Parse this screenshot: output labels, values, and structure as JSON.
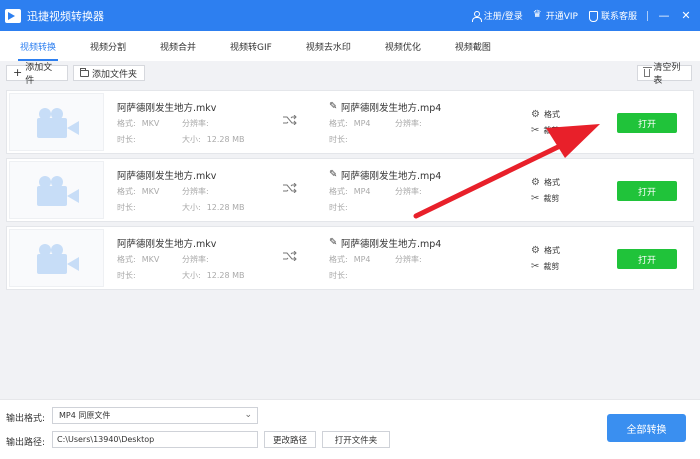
{
  "app": {
    "title": "迅捷视频转换器"
  },
  "topbar": {
    "login": "注册/登录",
    "vip": "开通VIP",
    "service": "联系客服",
    "minimize": "—",
    "close": "✕"
  },
  "tabs": [
    {
      "label": "视频转换",
      "active": true
    },
    {
      "label": "视频分割"
    },
    {
      "label": "视频合并"
    },
    {
      "label": "视频转GIF"
    },
    {
      "label": "视频去水印"
    },
    {
      "label": "视频优化"
    },
    {
      "label": "视频截图"
    }
  ],
  "toolbar": {
    "add_file": "添加文件",
    "add_folder": "添加文件夹",
    "clear_list": "清空列表"
  },
  "files": [
    {
      "src_name": "阿萨德刚发生地方.mkv",
      "src_format_label": "格式:",
      "src_format": "MKV",
      "src_res_label": "分辨率:",
      "src_duration_label": "时长:",
      "src_size_label": "大小:",
      "src_size": "12.28 MB",
      "dst_name": "阿萨德刚发生地方.mp4",
      "dst_format_label": "格式:",
      "dst_format": "MP4",
      "dst_res_label": "分辨率:",
      "dst_duration_label": "时长:",
      "settings": "格式",
      "trim": "裁剪",
      "open": "打开"
    },
    {
      "src_name": "阿萨德刚发生地方.mkv",
      "src_format_label": "格式:",
      "src_format": "MKV",
      "src_res_label": "分辨率:",
      "src_duration_label": "时长:",
      "src_size_label": "大小:",
      "src_size": "12.28 MB",
      "dst_name": "阿萨德刚发生地方.mp4",
      "dst_format_label": "格式:",
      "dst_format": "MP4",
      "dst_res_label": "分辨率:",
      "dst_duration_label": "时长:",
      "settings": "格式",
      "trim": "裁剪",
      "open": "打开"
    },
    {
      "src_name": "阿萨德刚发生地方.mkv",
      "src_format_label": "格式:",
      "src_format": "MKV",
      "src_res_label": "分辨率:",
      "src_duration_label": "时长:",
      "src_size_label": "大小:",
      "src_size": "12.28 MB",
      "dst_name": "阿萨德刚发生地方.mp4",
      "dst_format_label": "格式:",
      "dst_format": "MP4",
      "dst_res_label": "分辨率:",
      "dst_duration_label": "时长:",
      "settings": "格式",
      "trim": "裁剪",
      "open": "打开"
    }
  ],
  "bottom": {
    "format_label": "输出格式:",
    "format_value": "MP4  同原文件",
    "path_label": "输出路径:",
    "path_value": "C:\\Users\\13940\\Desktop",
    "change_path": "更改路径",
    "open_folder": "打开文件夹",
    "convert_all": "全部转换"
  },
  "colors": {
    "brand": "#2d7ff0",
    "open_button": "#20c33a",
    "annotation_arrow": "#e8202a"
  }
}
